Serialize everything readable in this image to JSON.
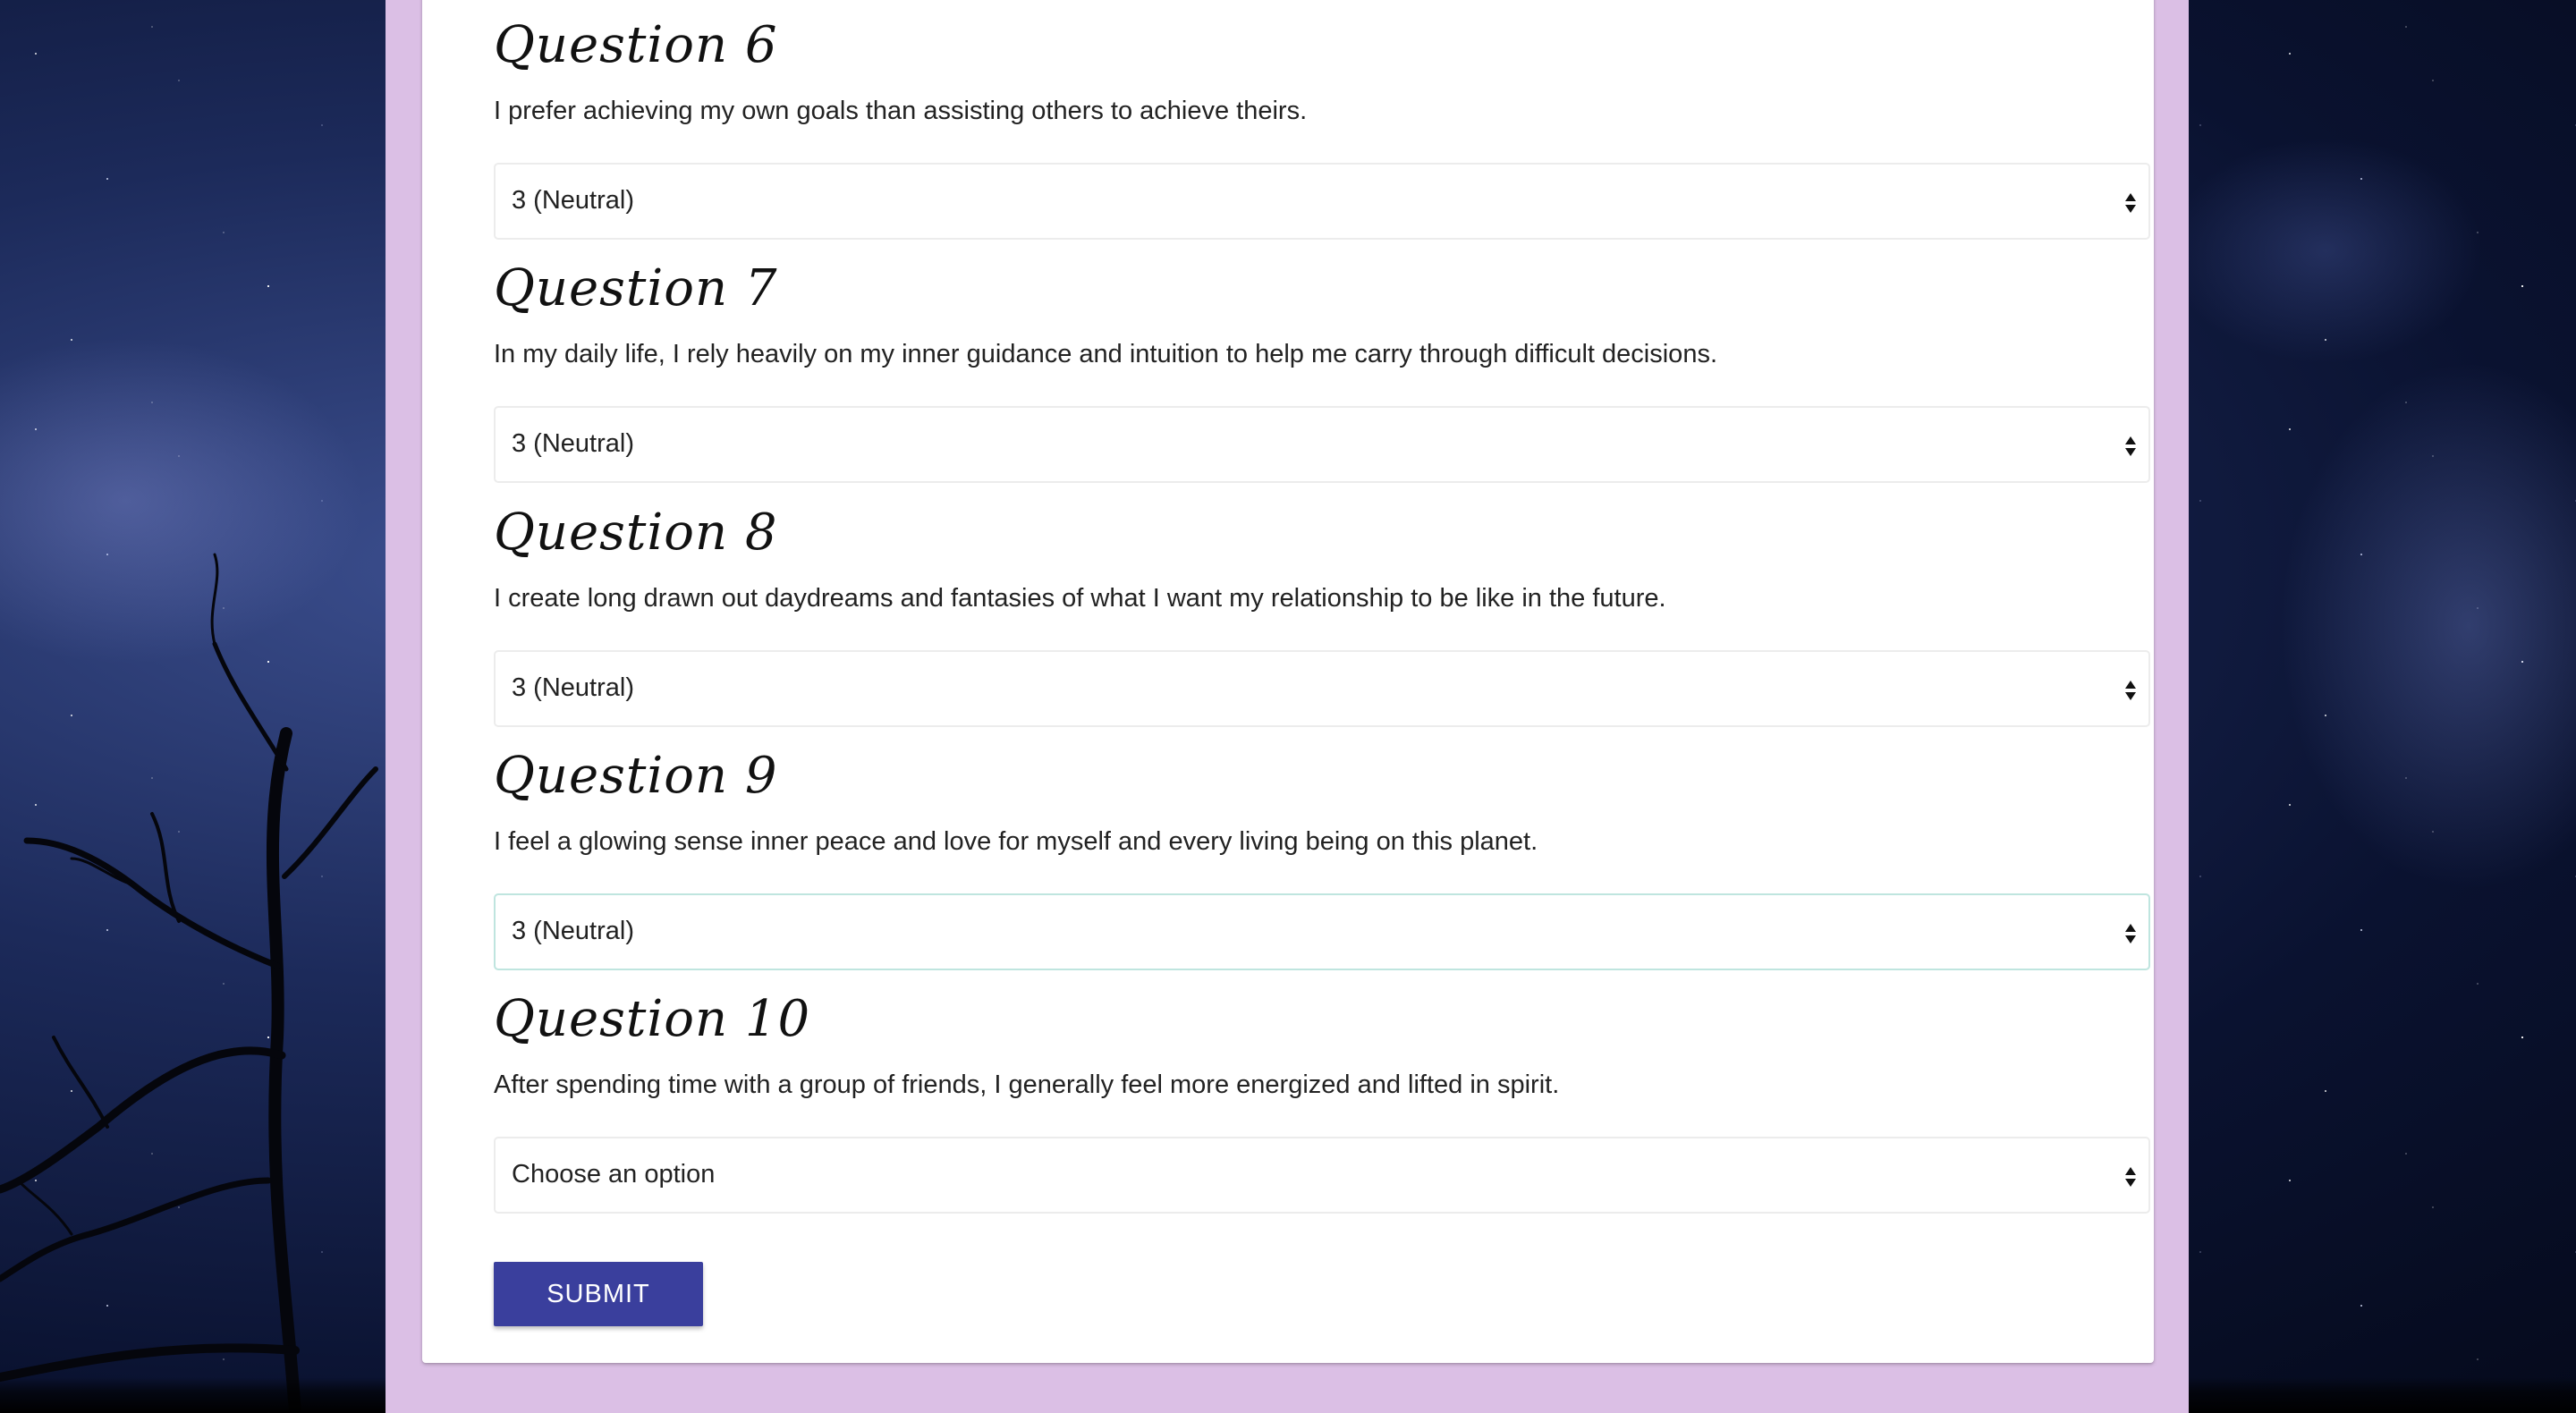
{
  "form": {
    "questions": [
      {
        "title": "Question 6",
        "text": "I prefer achieving my own goals than assisting others to achieve theirs.",
        "selected": "3 (Neutral)"
      },
      {
        "title": "Question 7",
        "text": "In my daily life, I rely heavily on my inner guidance and intuition to help me carry through difficult decisions.",
        "selected": "3 (Neutral)"
      },
      {
        "title": "Question 8",
        "text": "I create long drawn out daydreams and fantasies of what I want my relationship to be like in the future.",
        "selected": "3 (Neutral)"
      },
      {
        "title": "Question 9",
        "text": "I feel a glowing sense inner peace and love for myself and every living being on this planet.",
        "selected": "3 (Neutral)"
      },
      {
        "title": "Question 10",
        "text": "After spending time with a group of friends, I generally feel more energized and lifted in spirit.",
        "selected": "Choose an option"
      }
    ],
    "submit_label": "SUBMIT"
  },
  "colors": {
    "column_background": "#dbbfe5",
    "submit_button": "#3a3f9d",
    "focused_border": "#bfe5df"
  },
  "icons": {
    "select_arrows": "sort-arrows-icon"
  }
}
